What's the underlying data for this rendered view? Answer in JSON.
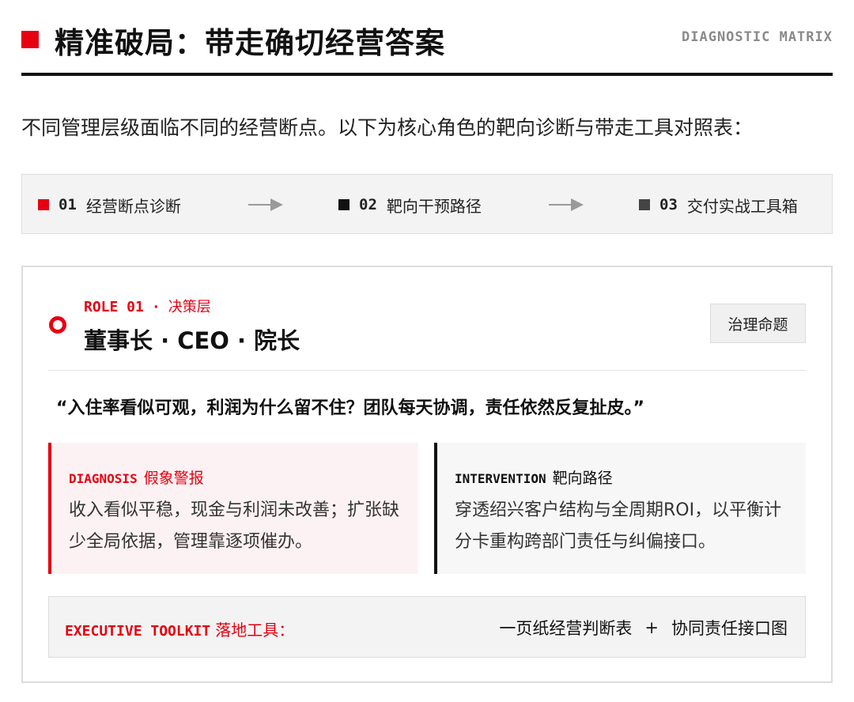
{
  "header": {
    "title": "精准破局：带走确切经营答案",
    "tag": "DIAGNOSTIC MATRIX",
    "accent_color": "#e60012"
  },
  "intro": "不同管理层级面临不同的经营断点。以下为核心角色的靶向诊断与带走工具对照表：",
  "steps": [
    {
      "num": "01",
      "label": "经营断点诊断",
      "color": "#e60012"
    },
    {
      "num": "02",
      "label": "靶向干预路径",
      "color": "#111111"
    },
    {
      "num": "03",
      "label": "交付实战工具箱",
      "color": "#444444"
    }
  ],
  "role": {
    "kicker_code": "ROLE 01",
    "kicker_sep": "·",
    "kicker_level": "决策层",
    "title": "董事长 · CEO · 院长",
    "badge": "治理命题",
    "quote": "“入住率看似可观，利润为什么留不住？团队每天协调，责任依然反复扯皮。”",
    "diagnosis": {
      "title_en": "DIAGNOSIS",
      "title_cn": "假象警报",
      "body": "收入看似平稳，现金与利润未改善；扩张缺少全局依据，管理靠逐项催办。"
    },
    "intervention": {
      "title_en": "INTERVENTION",
      "title_cn": "靶向路径",
      "body": "穿透绍兴客户结构与全周期ROI，以平衡计分卡重构跨部门责任与纠偏接口。"
    },
    "toolkit": {
      "label_en": "EXECUTIVE TOOLKIT",
      "label_cn": "落地工具：",
      "item1": "一页纸经营判断表",
      "plus": "+",
      "item2": "协同责任接口图"
    }
  }
}
